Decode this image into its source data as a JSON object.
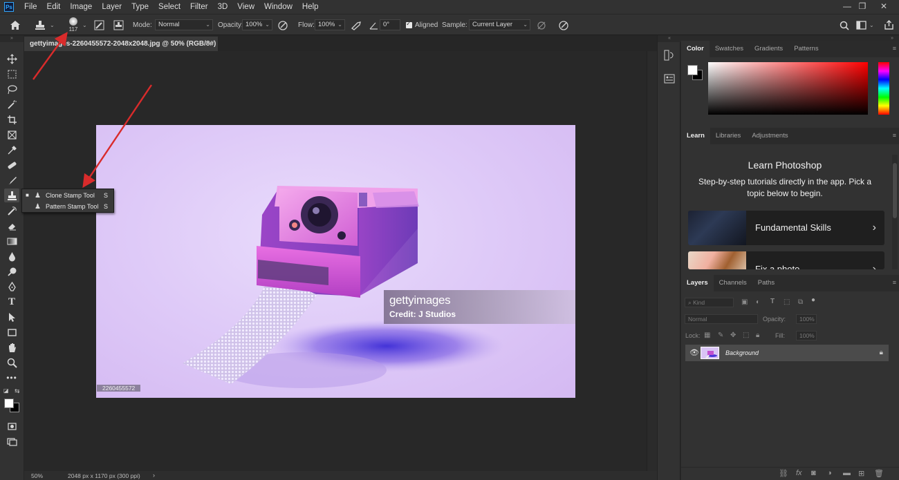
{
  "menu": {
    "items": [
      "File",
      "Edit",
      "Image",
      "Layer",
      "Type",
      "Select",
      "Filter",
      "3D",
      "View",
      "Window",
      "Help"
    ],
    "logo": "Ps"
  },
  "options": {
    "brush_size": "117",
    "mode_label": "Mode:",
    "mode_value": "Normal",
    "opacity_label": "Opacity:",
    "opacity_value": "100%",
    "flow_label": "Flow:",
    "flow_value": "100%",
    "angle_value": "0°",
    "aligned_label": "Aligned",
    "sample_label": "Sample:",
    "sample_value": "Current Layer"
  },
  "document": {
    "tab_title": "gettyimages-2260455572-2048x2048.jpg @ 50% (RGB/8#)",
    "credit_logo": "gettyimages",
    "credit_text": "Credit: J Studios",
    "image_id": "2260455572"
  },
  "status": {
    "zoom": "50%",
    "dimensions": "2048 px x 1170 px (300 ppi)"
  },
  "flyout": {
    "items": [
      {
        "label": "Clone Stamp Tool",
        "key": "S",
        "active": true
      },
      {
        "label": "Pattern Stamp Tool",
        "key": "S",
        "active": false
      }
    ]
  },
  "color_panel": {
    "tabs": [
      "Color",
      "Swatches",
      "Gradients",
      "Patterns"
    ]
  },
  "learn_panel": {
    "tabs": [
      "Learn",
      "Libraries",
      "Adjustments"
    ],
    "title": "Learn Photoshop",
    "subtitle": "Step-by-step tutorials directly in the app. Pick a topic below to begin.",
    "cards": [
      {
        "label": "Fundamental Skills"
      },
      {
        "label": "Fix a photo"
      }
    ]
  },
  "layers_panel": {
    "tabs": [
      "Layers",
      "Channels",
      "Paths"
    ],
    "kind_placeholder": "Kind",
    "blend_mode": "Normal",
    "opacity_label": "Opacity:",
    "opacity_value": "100%",
    "lock_label": "Lock:",
    "fill_label": "Fill:",
    "fill_value": "100%",
    "layer_name": "Background"
  },
  "colors": {
    "annotation_arrow": "#d92b2b",
    "canvas_bg": "#282828",
    "panel_bg": "#323232"
  }
}
